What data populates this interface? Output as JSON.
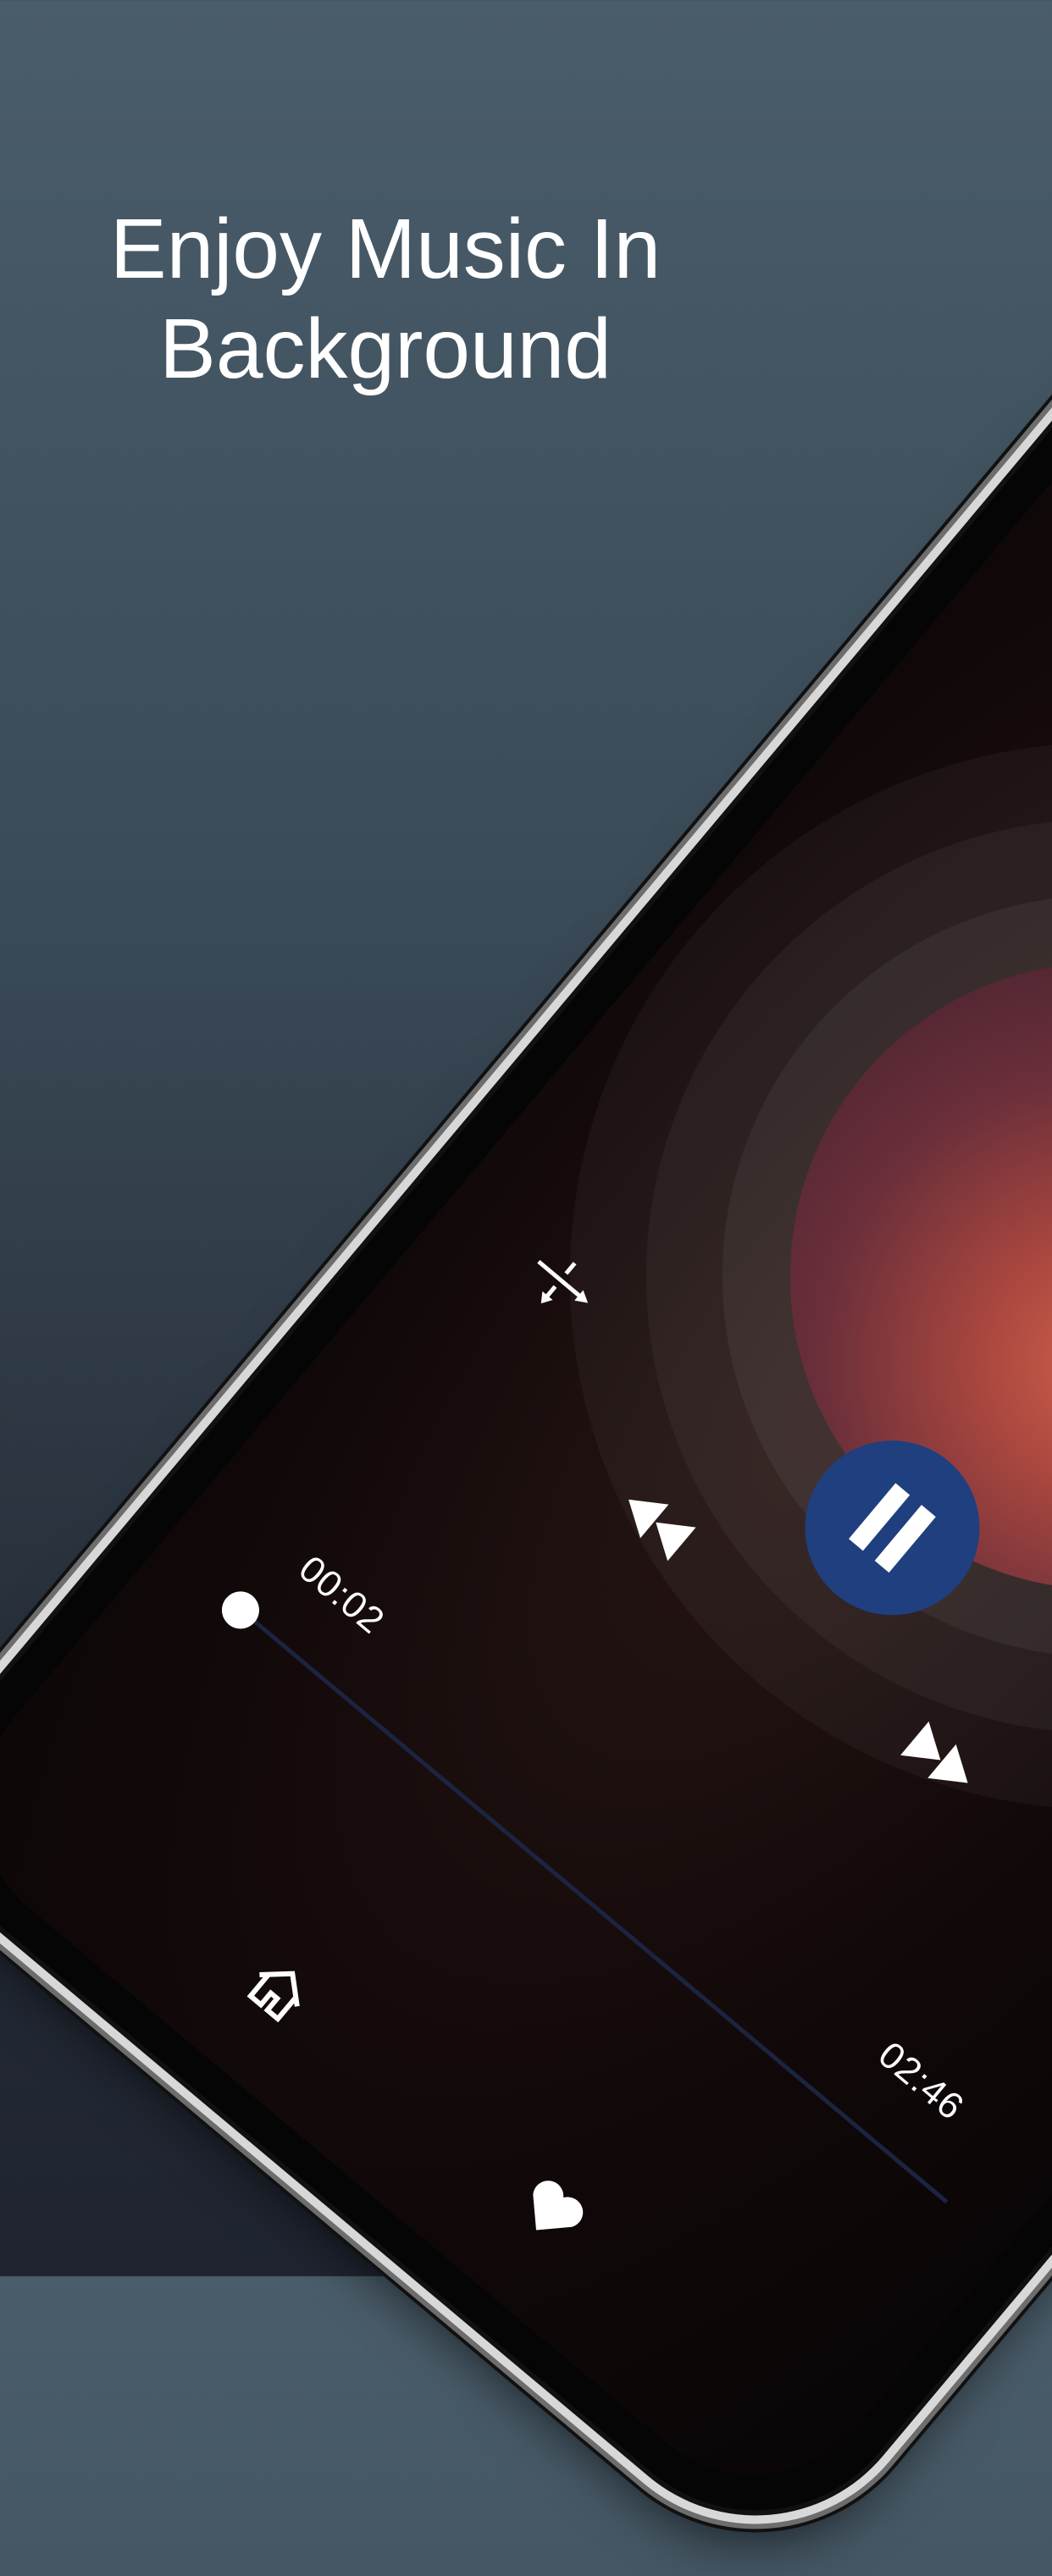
{
  "headline": {
    "line1": "Enjoy Music In",
    "line2": "Background"
  },
  "player": {
    "elapsed": "00:02",
    "duration": "02:46",
    "progress_fraction": 0.012,
    "state": "playing",
    "accent_color": "#1f3f7e"
  },
  "icons": {
    "shuffle": "shuffle-icon",
    "previous": "rewind-icon",
    "pause": "pause-icon",
    "next": "fast-forward-icon",
    "home": "home-icon",
    "favorite": "heart-icon"
  }
}
